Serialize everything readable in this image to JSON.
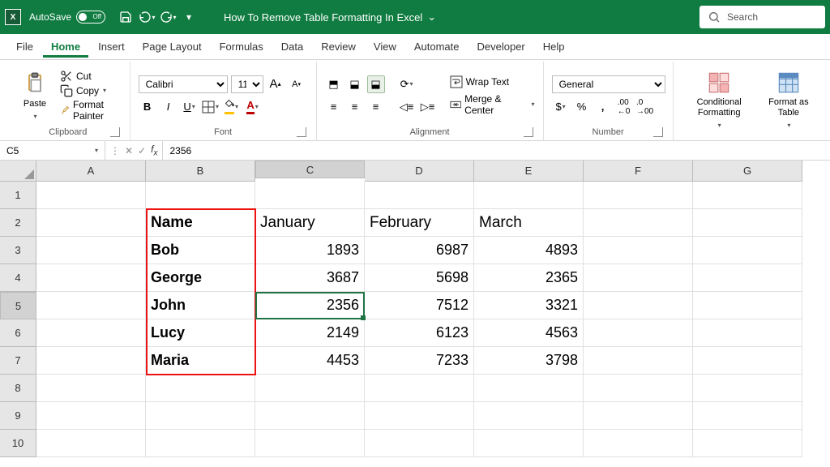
{
  "titlebar": {
    "autosave": "AutoSave",
    "toggle": "Off",
    "doc_title": "How To Remove Table Formatting In Excel",
    "search": "Search"
  },
  "tabs": [
    "File",
    "Home",
    "Insert",
    "Page Layout",
    "Formulas",
    "Data",
    "Review",
    "View",
    "Automate",
    "Developer",
    "Help"
  ],
  "active_tab": 1,
  "ribbon": {
    "clipboard": {
      "paste": "Paste",
      "cut": "Cut",
      "copy": "Copy",
      "painter": "Format Painter",
      "label": "Clipboard"
    },
    "font": {
      "name": "Calibri",
      "size": "11",
      "label": "Font"
    },
    "alignment": {
      "wrap": "Wrap Text",
      "merge": "Merge & Center",
      "label": "Alignment"
    },
    "number": {
      "format": "General",
      "label": "Number"
    },
    "styles": {
      "cond": "Conditional Formatting",
      "table": "Format as Table"
    }
  },
  "formula_bar": {
    "name_box": "C5",
    "value": "2356"
  },
  "columns": [
    "A",
    "B",
    "C",
    "D",
    "E",
    "F",
    "G"
  ],
  "rows": [
    "1",
    "2",
    "3",
    "4",
    "5",
    "6",
    "7",
    "8",
    "9",
    "10"
  ],
  "selected_col": 2,
  "selected_row": 4,
  "data": {
    "B2": "Name",
    "C2": "January",
    "D2": "February",
    "E2": "March",
    "B3": "Bob",
    "C3": "1893",
    "D3": "6987",
    "E3": "4893",
    "B4": "George",
    "C4": "3687",
    "D4": "5698",
    "E4": "2365",
    "B5": "John",
    "C5": "2356",
    "D5": "7512",
    "E5": "3321",
    "B6": "Lucy",
    "C6": "2149",
    "D6": "6123",
    "E6": "4563",
    "B7": "Maria",
    "C7": "4453",
    "D7": "7233",
    "E7": "3798"
  },
  "chart_data": {
    "type": "table",
    "title": "",
    "columns": [
      "Name",
      "January",
      "February",
      "March"
    ],
    "rows": [
      [
        "Bob",
        1893,
        6987,
        4893
      ],
      [
        "George",
        3687,
        5698,
        2365
      ],
      [
        "John",
        2356,
        7512,
        3321
      ],
      [
        "Lucy",
        2149,
        6123,
        4563
      ],
      [
        "Maria",
        4453,
        7233,
        3798
      ]
    ]
  }
}
